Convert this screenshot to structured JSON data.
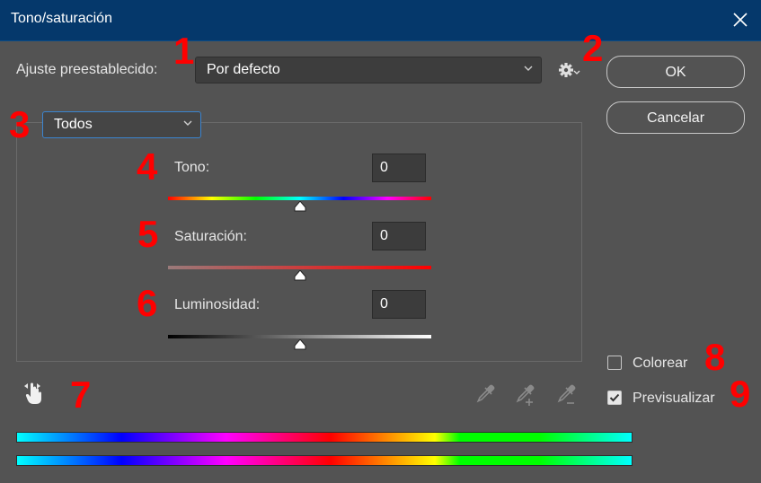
{
  "window": {
    "title": "Tono/saturación"
  },
  "preset": {
    "label": "Ajuste preestablecido:",
    "value": "Por defecto"
  },
  "channel": {
    "value": "Todos"
  },
  "buttons": {
    "ok": "OK",
    "cancel": "Cancelar"
  },
  "sliders": {
    "hue": {
      "label": "Tono:",
      "value": "0",
      "position": 0.5
    },
    "saturation": {
      "label": "Saturación:",
      "value": "0",
      "position": 0.5
    },
    "lightness": {
      "label": "Luminosidad:",
      "value": "0",
      "position": 0.5
    }
  },
  "options": {
    "colorize": {
      "label": "Colorear",
      "checked": false
    },
    "preview": {
      "label": "Previsualizar",
      "checked": true
    }
  },
  "annotations": [
    "1",
    "2",
    "3",
    "4",
    "5",
    "6",
    "7",
    "8",
    "9"
  ],
  "icons": {
    "close": "close-icon",
    "gear": "gear-icon",
    "chevron": "chevron-down-icon",
    "hand": "targeted-adjustment-hand-icon",
    "eyedropper": "eyedropper-icon",
    "eyedropper_add": "eyedropper-add-icon",
    "eyedropper_subtract": "eyedropper-subtract-icon"
  },
  "colors": {
    "titlebar": "#05386b",
    "background": "#535353",
    "annotation": "#ff0000"
  }
}
